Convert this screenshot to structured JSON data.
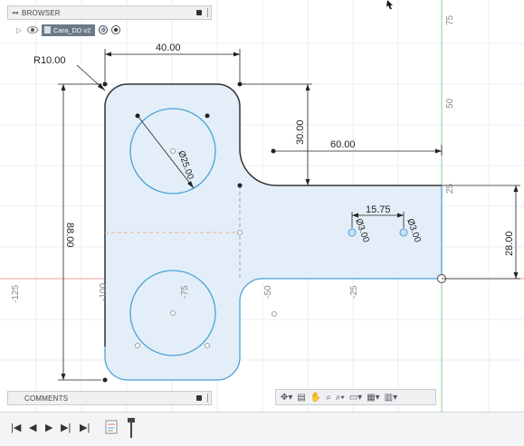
{
  "browser_panel": {
    "title": "BROWSER"
  },
  "browser_row": {
    "component_name": "Cara_DD v2"
  },
  "comments_panel": {
    "title": "COMMENTS"
  },
  "dimensions": {
    "radius": "R10.00",
    "top_width": "40.00",
    "step_height": "30.00",
    "arm_length": "60.00",
    "hole_spacing": "15.75",
    "small_hole_1": "Ø3.00",
    "small_hole_2": "Ø3.00",
    "arm_height": "28.00",
    "total_height": "88.00",
    "circle_diameter": "Ø25.00"
  },
  "axis_labels": {
    "v_75": "75",
    "v_50": "50",
    "v_25": "25",
    "h_m125": "-125",
    "h_m100": "-100",
    "h_m75": "-75",
    "h_m50": "-50",
    "h_m25": "-25"
  },
  "colors": {
    "profile_fill": "#e4eef8",
    "sketch_line": "#4aa3d6",
    "x_axis": "#e8a0a0",
    "y_axis": "#8bd08b"
  },
  "nav_toolbar": {
    "icons": [
      "orbit-icon",
      "pan-icon",
      "look-at-icon",
      "zoom-icon",
      "zoom-window-icon",
      "display-settings-icon",
      "grid-icon",
      "viewports-icon"
    ]
  },
  "timeline": {
    "icons": [
      "first-icon",
      "previous-icon",
      "play-icon",
      "next-icon",
      "last-icon"
    ]
  }
}
